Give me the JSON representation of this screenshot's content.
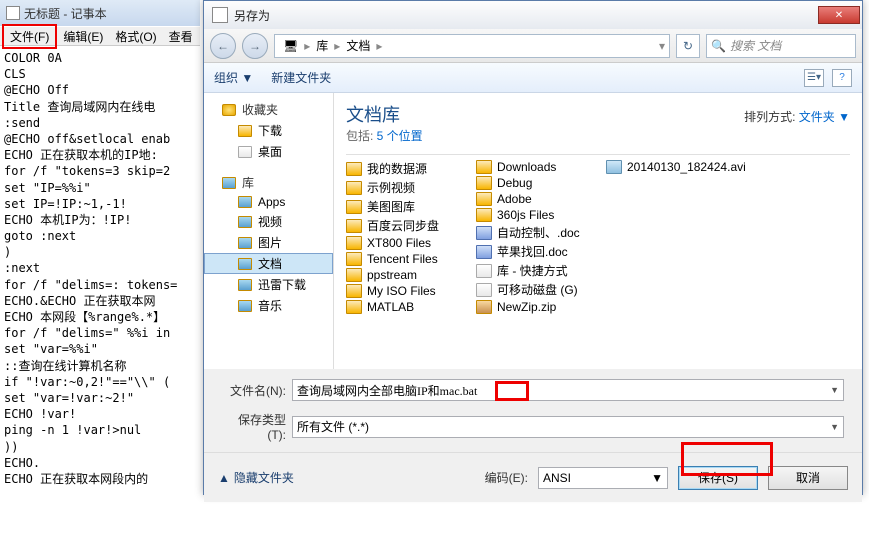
{
  "notepad": {
    "title": "无标题 - 记事本",
    "menu": {
      "file": "文件(F)",
      "edit": "编辑(E)",
      "format": "格式(O)",
      "view": "查看"
    },
    "content": "COLOR 0A\nCLS\n@ECHO Off\nTitle 查询局域网内在线电\n:send\n@ECHO off&setlocal enab\nECHO 正在获取本机的IP地:\nfor /f \"tokens=3 skip=2\nset \"IP=%%i\"\nset IP=!IP:~1,-1!\nECHO 本机IP为：!IP!\ngoto :next\n)\n:next\nfor /f \"delims=: tokens=\nECHO.&ECHO 正在获取本网\nECHO 本网段【%range%.*】\nfor /f \"delims=\" %%i in\nset \"var=%%i\"\n::查询在线计算机名称\nif \"!var:~0,2!\"==\"\\\\\" (\nset \"var=!var:~2!\"\nECHO !var!\nping -n 1 !var!>nul\n))\nECHO.\nECHO 正在获取本网段内的"
  },
  "dialog": {
    "title": "另存为",
    "breadcrumb": {
      "root_icon": "🖥",
      "seg1": "库",
      "seg2": "文档"
    },
    "search_placeholder": "搜索 文档",
    "toolbar": {
      "organize": "组织 ▼",
      "newfolder": "新建文件夹"
    },
    "sidebar": {
      "fav": "收藏夹",
      "downloads": "下载",
      "desktop": "桌面",
      "lib": "库",
      "apps": "Apps",
      "video": "视频",
      "pictures": "图片",
      "docs": "文档",
      "xunlei": "迅雷下载",
      "music": "音乐"
    },
    "library": {
      "title": "文档库",
      "subtitle_prefix": "包括: ",
      "subtitle_link": "5 个位置",
      "sort_label": "排列方式:",
      "sort_value": "文件夹 ▼"
    },
    "files_col1": [
      "我的数据源",
      "示例视频",
      "美图图库",
      "百度云同步盘",
      "XT800 Files",
      "Tencent Files",
      "ppstream",
      "My ISO Files",
      "MATLAB"
    ],
    "files_col2": [
      {
        "n": "Downloads",
        "t": "folder"
      },
      {
        "n": "Debug",
        "t": "folder"
      },
      {
        "n": "Adobe",
        "t": "folder"
      },
      {
        "n": "360js Files",
        "t": "folder"
      },
      {
        "n": "自动控制、.doc",
        "t": "doc"
      },
      {
        "n": "苹果找回.doc",
        "t": "doc"
      },
      {
        "n": "库 - 快捷方式",
        "t": "file"
      },
      {
        "n": "可移动磁盘 (G)",
        "t": "file"
      },
      {
        "n": "NewZip.zip",
        "t": "zip"
      }
    ],
    "files_col3": [
      {
        "n": "20140130_182424.avi",
        "t": "avi"
      }
    ],
    "filename_label": "文件名(N):",
    "filename_value": "查询局域网内全部电脑IP和mac.bat",
    "filetype_label": "保存类型(T):",
    "filetype_value": "所有文件 (*.*)",
    "hide_folders": "隐藏文件夹",
    "encoding_label": "编码(E):",
    "encoding_value": "ANSI",
    "save_btn": "保存(S)",
    "cancel_btn": "取消"
  }
}
